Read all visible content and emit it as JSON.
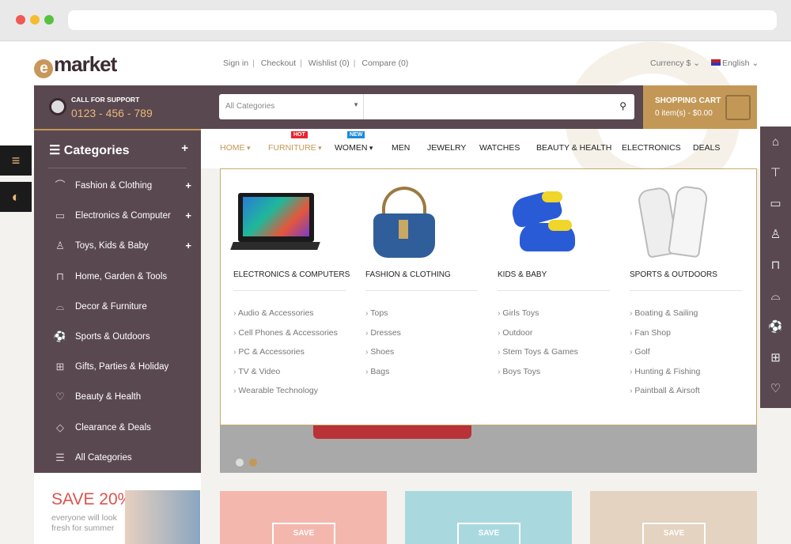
{
  "logo": {
    "mark": "e",
    "text": "market"
  },
  "top_links": [
    "Sign in",
    "Checkout",
    "Wishlist (0)",
    "Compare (0)"
  ],
  "currency": "Currency $",
  "language": "English",
  "support": {
    "label": "CALL FOR SUPPORT",
    "phone": "0123 - 456 - 789"
  },
  "search": {
    "category": "All Categories",
    "query": ""
  },
  "cart": {
    "title": "SHOPPING CART",
    "summary": "0 item(s) - $0.00"
  },
  "sidebar": {
    "title": "Categories",
    "items": [
      {
        "label": "Fashion & Clothing",
        "icon": "hanger-icon",
        "expandable": true
      },
      {
        "label": "Electronics & Computer",
        "icon": "monitor-icon",
        "expandable": true
      },
      {
        "label": "Toys, Kids & Baby",
        "icon": "onesie-icon",
        "expandable": true
      },
      {
        "label": "Home, Garden & Tools",
        "icon": "paint-roller-icon",
        "expandable": false
      },
      {
        "label": "Decor & Furniture",
        "icon": "sofa-icon",
        "expandable": false
      },
      {
        "label": "Sports & Outdoors",
        "icon": "soccer-ball-icon",
        "expandable": false
      },
      {
        "label": "Gifts, Parties & Holiday",
        "icon": "gift-icon",
        "expandable": false
      },
      {
        "label": "Beauty & Health",
        "icon": "heart-icon",
        "expandable": false
      },
      {
        "label": "Clearance & Deals",
        "icon": "tag-icon",
        "expandable": false
      },
      {
        "label": "All Categories",
        "icon": "menu-icon",
        "expandable": false
      }
    ]
  },
  "nav": [
    {
      "label": "HOME",
      "active": true,
      "caret": true
    },
    {
      "label": "FURNITURE",
      "active": true,
      "caret": true,
      "badge": "HOT"
    },
    {
      "label": "WOMEN",
      "caret": true,
      "badge": "NEW"
    },
    {
      "label": "MEN"
    },
    {
      "label": "JEWELRY"
    },
    {
      "label": "WATCHES"
    },
    {
      "label": "BEAUTY & HEALTH"
    },
    {
      "label": "ELECTRONICS"
    },
    {
      "label": "DEALS"
    }
  ],
  "mega_menu": [
    {
      "heading": "ELECTRONICS & COMPUTERS",
      "links": [
        "Audio & Accessories",
        "Cell Phones & Accessories",
        "PC & Accessories",
        "TV & Video",
        "Wearable Technology"
      ]
    },
    {
      "heading": "FASHION & CLOTHING",
      "links": [
        "Tops",
        "Dresses",
        "Shoes",
        "Bags"
      ]
    },
    {
      "heading": "KIDS & BABY",
      "links": [
        "Girls Toys",
        "Outdoor",
        "Stem Toys & Games",
        "Boys Toys"
      ]
    },
    {
      "heading": "SPORTS & OUTDOORS",
      "links": [
        "Boating & Sailing",
        "Fan Shop",
        "Golf",
        "Hunting & Fishing",
        "Paintball & Airsoft"
      ]
    }
  ],
  "promo": {
    "headline": "SAVE 20%",
    "text": "everyone will look fresh for summer"
  },
  "tiles": [
    {
      "label": "SAVE"
    },
    {
      "label": "SAVE"
    },
    {
      "label": "SAVE"
    }
  ],
  "colors": {
    "accent": "#c39856",
    "dark": "#5a4850",
    "hot": "#e8232f",
    "new": "#1a8bd6"
  }
}
